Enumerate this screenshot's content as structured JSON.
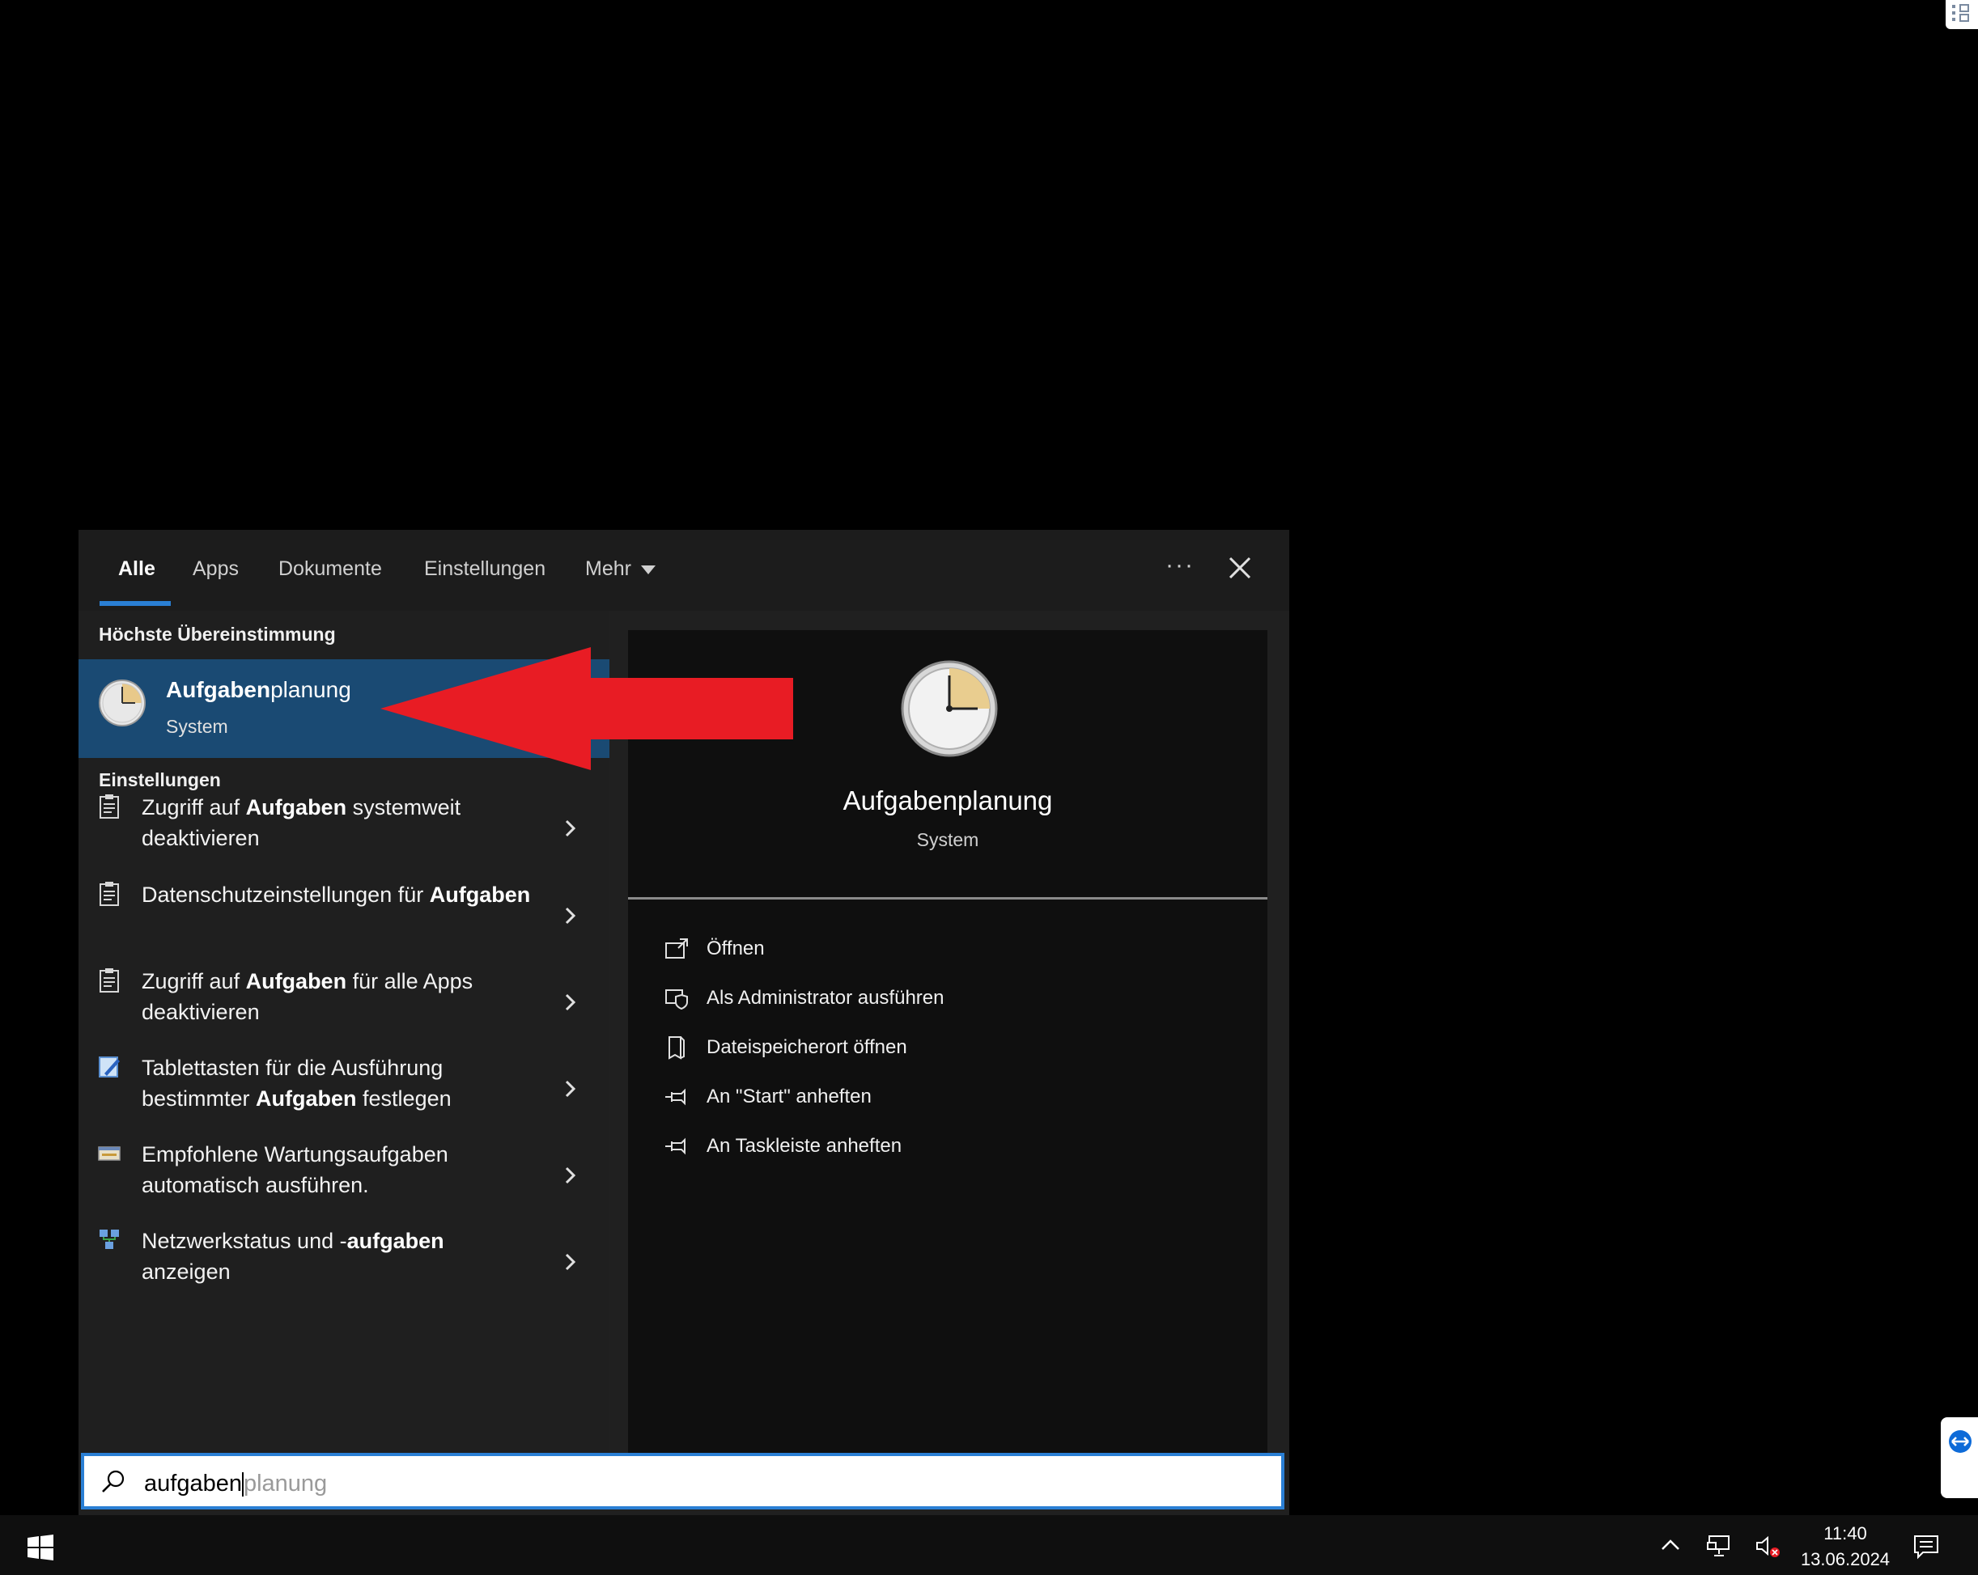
{
  "tabs": [
    {
      "label": "Alle",
      "active": true
    },
    {
      "label": "Apps"
    },
    {
      "label": "Dokumente"
    },
    {
      "label": "Einstellungen"
    },
    {
      "label": "Mehr"
    }
  ],
  "left": {
    "section_best": "Höchste Übereinstimmung",
    "best_match": {
      "title_bold": "Aufgaben",
      "title_rest": "planung",
      "subtitle": "System",
      "icon": "task-scheduler-clock-icon"
    },
    "section_settings": "Einstellungen",
    "items": [
      {
        "parts": [
          {
            "t": "Zugriff auf "
          },
          {
            "t": "Aufgaben",
            "b": true
          },
          {
            "t": " systemweit deaktivieren"
          }
        ],
        "icon": "clipboard-icon"
      },
      {
        "parts": [
          {
            "t": "Datenschutzeinstellungen für "
          },
          {
            "t": "Aufgaben",
            "b": true
          }
        ],
        "icon": "clipboard-icon"
      },
      {
        "parts": [
          {
            "t": "Zugriff auf "
          },
          {
            "t": "Aufgaben",
            "b": true
          },
          {
            "t": " für alle Apps deaktivieren"
          }
        ],
        "icon": "clipboard-icon"
      },
      {
        "parts": [
          {
            "t": "Tablettasten für die Ausführung bestimmter "
          },
          {
            "t": "Aufgaben",
            "b": true
          },
          {
            "t": " festlegen"
          }
        ],
        "icon": "tablet-pen-icon"
      },
      {
        "parts": [
          {
            "t": "Empfohlene Wartungsaufgaben automatisch ausführen."
          }
        ],
        "icon": "maintenance-icon"
      },
      {
        "parts": [
          {
            "t": "Netzwerkstatus und -"
          },
          {
            "t": "aufgaben",
            "b": true
          },
          {
            "t": " anzeigen"
          }
        ],
        "icon": "network-icon"
      }
    ]
  },
  "right": {
    "title": "Aufgabenplanung",
    "subtitle": "System",
    "actions": [
      {
        "label": "Öffnen",
        "icon": "open-icon"
      },
      {
        "label": "Als Administrator ausführen",
        "icon": "admin-shield-icon"
      },
      {
        "label": "Dateispeicherort öffnen",
        "icon": "file-location-icon"
      },
      {
        "label": "An \"Start\" anheften",
        "icon": "pin-icon"
      },
      {
        "label": "An Taskleiste anheften",
        "icon": "pin-icon"
      }
    ]
  },
  "search": {
    "typed": "aufgaben",
    "hint": "planung"
  },
  "taskbar": {
    "time": "11:40",
    "date": "13.06.2024"
  },
  "colors": {
    "accent": "#2a7fd4",
    "selection": "#1a4a73",
    "arrow": "#e81c24"
  }
}
